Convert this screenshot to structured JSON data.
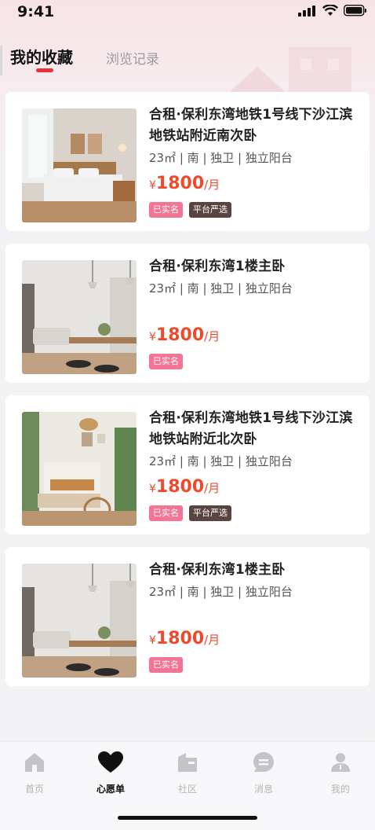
{
  "status_bar": {
    "time": "9:41"
  },
  "tabs": {
    "favorites": "我的收藏",
    "history": "浏览记录"
  },
  "listings": [
    {
      "title": "合租·保利东湾地铁1号线下沙江滨地铁站附近南次卧",
      "specs": "23㎡ | 南 | 独卫 | 独立阳台",
      "currency": "¥",
      "price": "1800",
      "unit": "/月",
      "tags": [
        "已实名",
        "平台严选"
      ]
    },
    {
      "title": "合租·保利东湾1楼主卧",
      "specs": "23㎡ | 南 | 独卫 | 独立阳台",
      "currency": "¥",
      "price": "1800",
      "unit": "/月",
      "tags": [
        "已实名"
      ]
    },
    {
      "title": "合租·保利东湾地铁1号线下沙江滨地铁站附近北次卧",
      "specs": "23㎡ | 南 | 独卫 | 独立阳台",
      "currency": "¥",
      "price": "1800",
      "unit": "/月",
      "tags": [
        "已实名",
        "平台严选"
      ]
    },
    {
      "title": "合租·保利东湾1楼主卧",
      "specs": "23㎡ | 南 | 独卫 | 独立阳台",
      "currency": "¥",
      "price": "1800",
      "unit": "/月",
      "tags": [
        "已实名"
      ]
    }
  ],
  "tabbar": {
    "items": [
      {
        "label": "首页",
        "icon": "home-icon"
      },
      {
        "label": "心愿单",
        "icon": "heart-icon"
      },
      {
        "label": "社区",
        "icon": "community-icon"
      },
      {
        "label": "消息",
        "icon": "message-icon"
      },
      {
        "label": "我的",
        "icon": "profile-icon"
      }
    ],
    "active_index": 1
  },
  "colors": {
    "accent": "#e8313c",
    "price": "#ef4a2c",
    "tag_real": "#f27596",
    "tag_strict": "#5b4440"
  }
}
